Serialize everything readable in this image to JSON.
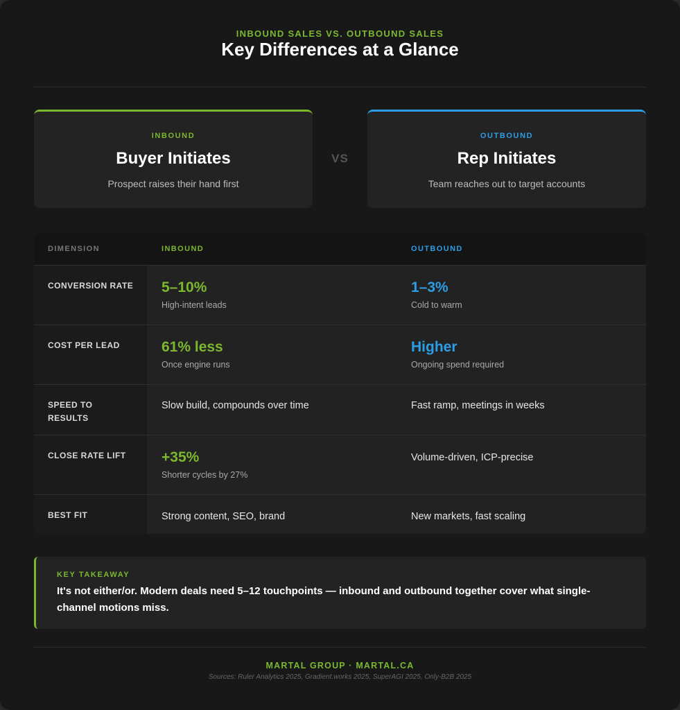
{
  "header": {
    "eyebrow": "INBOUND SALES VS. OUTBOUND SALES",
    "title": "Key Differences at a Glance"
  },
  "colors": {
    "inbound": "#7cb82f",
    "outbound": "#2d9ee6",
    "background": "#181818"
  },
  "hero": {
    "inbound": {
      "tag": "INBOUND",
      "title": "Buyer Initiates",
      "subtitle": "Prospect raises their hand first"
    },
    "vs": "VS",
    "outbound": {
      "tag": "OUTBOUND",
      "title": "Rep Initiates",
      "subtitle": "Team reaches out to target accounts"
    }
  },
  "table": {
    "headers": {
      "dimension": "DIMENSION",
      "inbound": "INBOUND",
      "outbound": "OUTBOUND"
    },
    "rows": [
      {
        "label": "CONVERSION RATE",
        "inbound": {
          "big": "5–10%",
          "small": "High-intent leads"
        },
        "outbound": {
          "big": "1–3%",
          "small": "Cold to warm"
        }
      },
      {
        "label": "COST PER LEAD",
        "inbound": {
          "big": "61% less",
          "small": "Once engine runs"
        },
        "outbound": {
          "big": "Higher",
          "small": "Ongoing spend required"
        }
      },
      {
        "label": "SPEED TO RESULTS",
        "inbound": {
          "text": "Slow build, compounds over time"
        },
        "outbound": {
          "text": "Fast ramp, meetings in weeks"
        }
      },
      {
        "label": "CLOSE RATE LIFT",
        "inbound": {
          "big": "+35%",
          "small": "Shorter cycles by 27%"
        },
        "outbound": {
          "text": "Volume-driven, ICP-precise"
        }
      },
      {
        "label": "BEST FIT",
        "inbound": {
          "text": "Strong content, SEO, brand"
        },
        "outbound": {
          "text": "New markets, fast scaling"
        }
      }
    ]
  },
  "takeaway": {
    "label": "KEY TAKEAWAY",
    "text": "It's not either/or. Modern deals need 5–12 touchpoints — inbound and outbound together cover what single-channel motions miss."
  },
  "footer": {
    "brand": "MARTAL GROUP · MARTAL.CA",
    "sources": "Sources: Ruler Analytics 2025, Gradient.works 2025, SuperAGI 2025, Only-B2B 2025"
  }
}
